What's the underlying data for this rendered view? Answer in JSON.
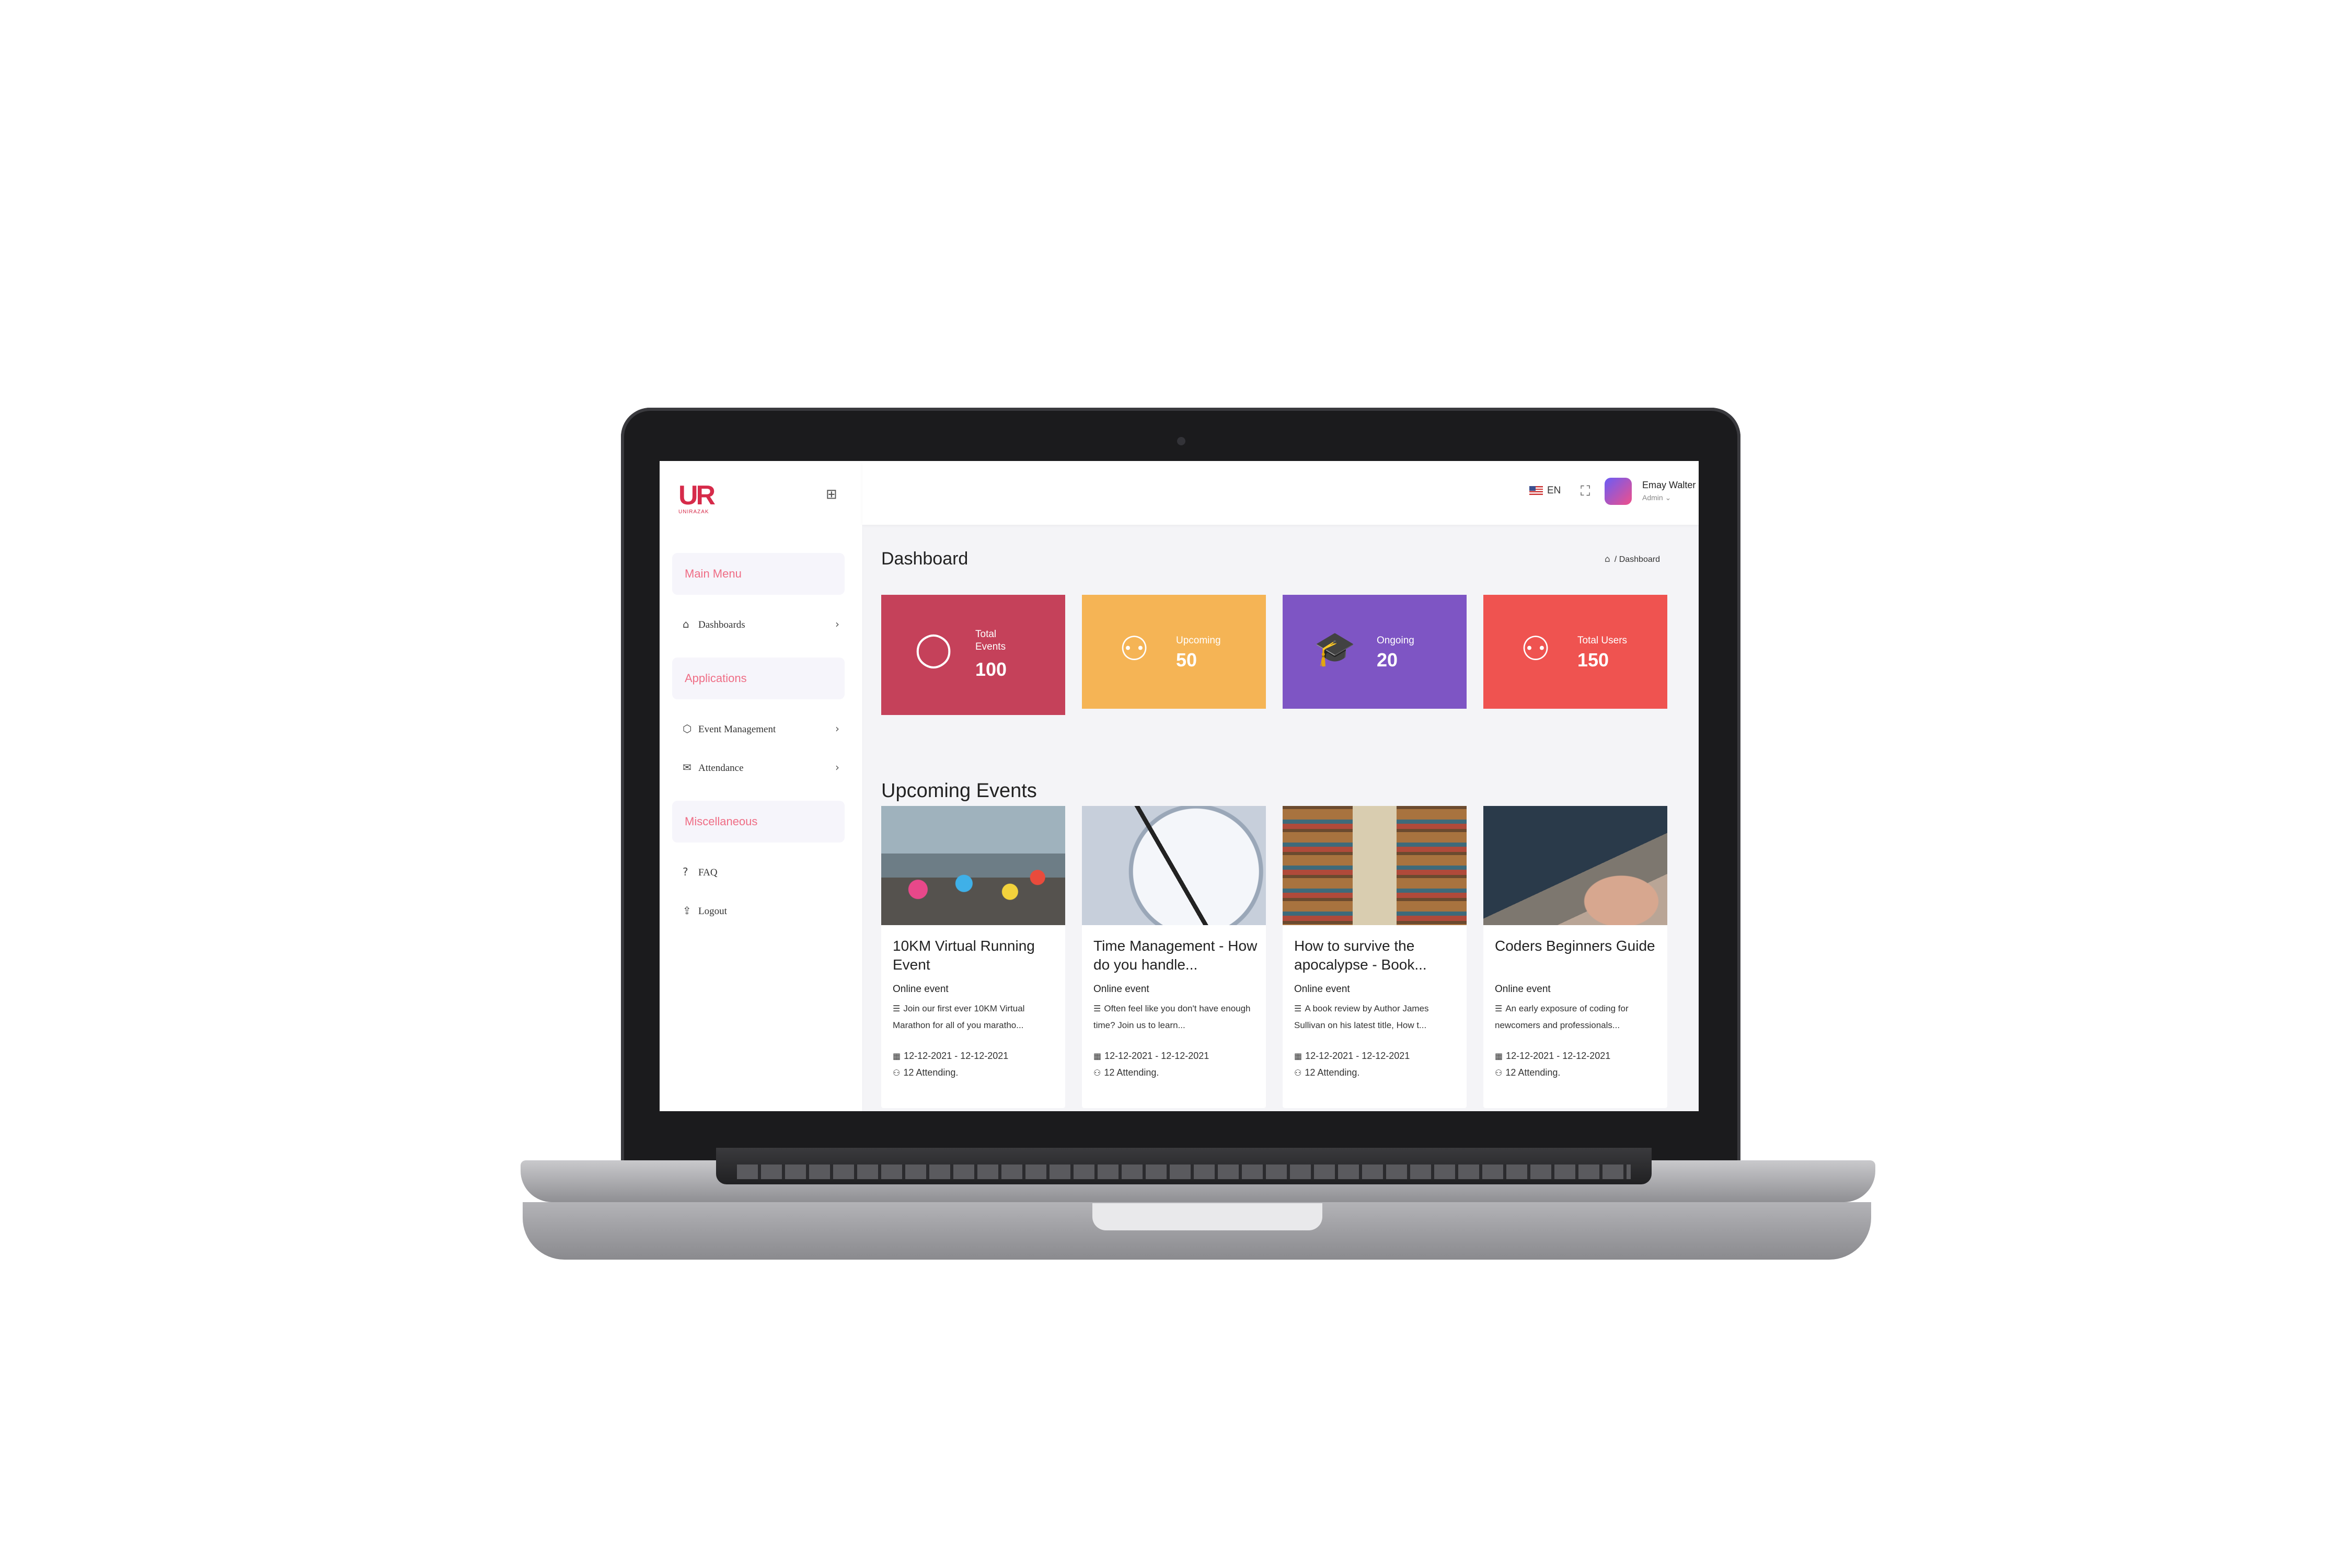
{
  "brand": {
    "logo_text": "UR",
    "logo_sub": "UNIRAZAK",
    "accent": "#d62b4a"
  },
  "sidebar": {
    "sections": [
      {
        "label": "Main Menu"
      },
      {
        "label": "Applications"
      },
      {
        "label": "Miscellaneous"
      }
    ],
    "items": [
      {
        "label": "Dashboards",
        "icon": "home-icon"
      },
      {
        "label": "Event Management",
        "icon": "cube-icon"
      },
      {
        "label": "Attendance",
        "icon": "mail-icon"
      },
      {
        "label": "FAQ",
        "icon": "help-circle-icon"
      },
      {
        "label": "Logout",
        "icon": "logout-icon"
      }
    ]
  },
  "topbar": {
    "language": "EN",
    "user_name": "Emay Walter",
    "user_role": "Admin"
  },
  "page": {
    "title": "Dashboard",
    "breadcrumb": "Dashboard"
  },
  "stats": [
    {
      "label": "Total Events",
      "value": "100",
      "color": "#c5415a",
      "icon": "user-circle-icon"
    },
    {
      "label": "Upcoming",
      "value": "50",
      "color": "#f5b455",
      "icon": "group-icon"
    },
    {
      "label": "Ongoing",
      "value": "20",
      "color": "#7e55c4",
      "icon": "graduation-cap-icon"
    },
    {
      "label": "Total Users",
      "value": "150",
      "color": "#ef5350",
      "icon": "group-icon"
    }
  ],
  "upcoming": {
    "title": "Upcoming Events",
    "cards": [
      {
        "title": "10KM Virtual Running Event",
        "type": "Online event",
        "desc": "Join our first ever 10KM Virtual Marathon for all of you maratho...",
        "date": "12-12-2021 - 12-12-2021",
        "attending": "12 Attending."
      },
      {
        "title": "Time Management - How do you handle...",
        "type": "Online event",
        "desc": "Often feel like you don't have enough time? Join us to learn...",
        "date": "12-12-2021 - 12-12-2021",
        "attending": "12 Attending."
      },
      {
        "title": "How to survive the apocalypse - Book...",
        "type": "Online event",
        "desc": "A book review by Author James Sullivan on his latest title, How t...",
        "date": "12-12-2021 - 12-12-2021",
        "attending": "12 Attending."
      },
      {
        "title": "Coders Beginners Guide",
        "type": "Online event",
        "desc": "An early exposure of coding for newcomers and professionals...",
        "date": "12-12-2021 - 12-12-2021",
        "attending": "12 Attending."
      }
    ]
  }
}
